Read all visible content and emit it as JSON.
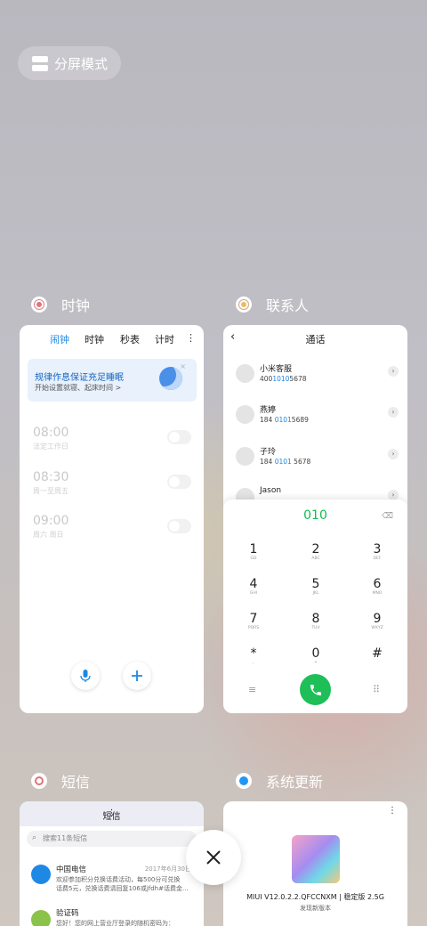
{
  "split_mode": {
    "label": "分屏模式",
    "icon": "split-screen-icon"
  },
  "clock_app": {
    "title": "时钟",
    "icon": "clock-app-icon",
    "tabs": [
      "闹钟",
      "时钟",
      "秒表",
      "计时"
    ],
    "banner": {
      "title": "规律作息保证充足睡眠",
      "subtitle": "开始设置就寝、起床时间 >"
    },
    "alarms": [
      {
        "time": "08:00",
        "label": "法定工作日"
      },
      {
        "time": "08:30",
        "label": "周一至周五"
      },
      {
        "time": "09:00",
        "label": "周六 周日"
      }
    ]
  },
  "contacts_app": {
    "title": "联系人",
    "icon": "contacts-app-icon",
    "header": "通话",
    "contacts": [
      {
        "name": "小米客服",
        "pre": "400",
        "hl": "1010",
        "post": "5678"
      },
      {
        "name": "燕婷",
        "pre": "184 ",
        "hl": "0101",
        "post": "5689"
      },
      {
        "name": "子玲",
        "pre": "184 ",
        "hl": "0101",
        "post": " 5678"
      },
      {
        "name": "Jason",
        "pre": "",
        "hl": "",
        "post": ""
      }
    ],
    "dialed": "010",
    "keys": [
      {
        "n": "1",
        "s": "GD"
      },
      {
        "n": "2",
        "s": "ABC"
      },
      {
        "n": "3",
        "s": "DEF"
      },
      {
        "n": "4",
        "s": "GHI"
      },
      {
        "n": "5",
        "s": "JKL"
      },
      {
        "n": "6",
        "s": "MNO"
      },
      {
        "n": "7",
        "s": "PQRS"
      },
      {
        "n": "8",
        "s": "TUV"
      },
      {
        "n": "9",
        "s": "WXYZ"
      },
      {
        "n": "*",
        "s": ","
      },
      {
        "n": "0",
        "s": "+"
      },
      {
        "n": "#",
        "s": ""
      }
    ]
  },
  "sms_app": {
    "title": "短信",
    "icon": "sms-app-icon",
    "header": "短信",
    "search_placeholder": "搜索11条短信",
    "messages": [
      {
        "sender": "中国电信",
        "date": "2017年6月30日",
        "preview1": "欢迎参加积分兑换话费活动，每500分可兑换",
        "preview2": "话费5元，兑换话费请回复106或jfdh#话费金..."
      },
      {
        "sender": "验证码",
        "date": "",
        "preview1": "您好！您的网上营业厅登录的随机密码为：",
        "preview2": ""
      }
    ]
  },
  "update_app": {
    "title": "系统更新",
    "icon": "update-app-icon",
    "version": "MIUI V12.0.2.2.QFCCNXM | 稳定版 2.5G",
    "subtitle": "发现新版本"
  },
  "colors": {
    "accent": "#1e88e5",
    "call_green": "#1ebf58"
  }
}
